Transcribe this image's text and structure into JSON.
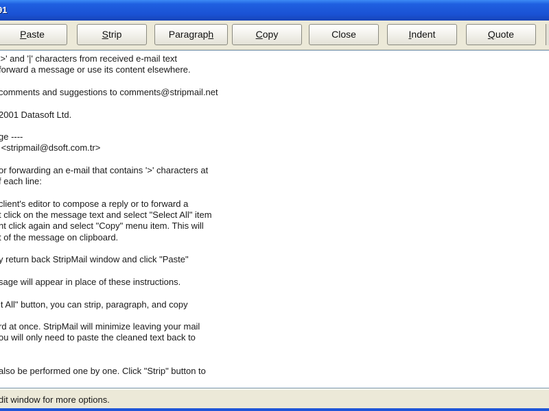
{
  "window": {
    "title": "91"
  },
  "toolbar": {
    "buttons": [
      {
        "pre": "",
        "acc": "P",
        "post": "aste"
      },
      {
        "pre": "",
        "acc": "S",
        "post": "trip"
      },
      {
        "pre": "Paragrap",
        "acc": "h",
        "post": ""
      },
      {
        "pre": "",
        "acc": "C",
        "post": "opy"
      },
      {
        "pre": "Close",
        "acc": "",
        "post": ""
      },
      {
        "pre": "",
        "acc": "I",
        "post": "ndent"
      },
      {
        "pre": "",
        "acc": "Q",
        "post": "uote"
      }
    ]
  },
  "content": {
    "lines": [
      "'>' and '|' characters from received e-mail text",
      "forward a message or use its content elsewhere.",
      "",
      "comments and suggestions to comments@stripmail.net",
      "",
      "2001 Datasoft Ltd.",
      "",
      "ge ----",
      " <stripmail@dsoft.com.tr>",
      "",
      "or forwarding an e-mail that contains '>' characters at",
      "f each line:",
      "",
      "client's editor to compose a reply or to forward a",
      "t click on the message text and select \"Select All\" item",
      "nt click again and select \"Copy\" menu item. This will",
      "t of the message on clipboard.",
      "",
      "y return back StripMail window and click \"Paste\"",
      "",
      "sage will appear in place of these instructions.",
      "",
      "lt All\" button, you can strip, paragraph, and copy",
      "",
      "rd at once. StripMail will minimize leaving your mail",
      "ou will only need to paste the cleaned text back to",
      "",
      "",
      "also be performed one by one. Click \"Strip\" button to"
    ]
  },
  "status": {
    "text": "dit window for more options."
  }
}
